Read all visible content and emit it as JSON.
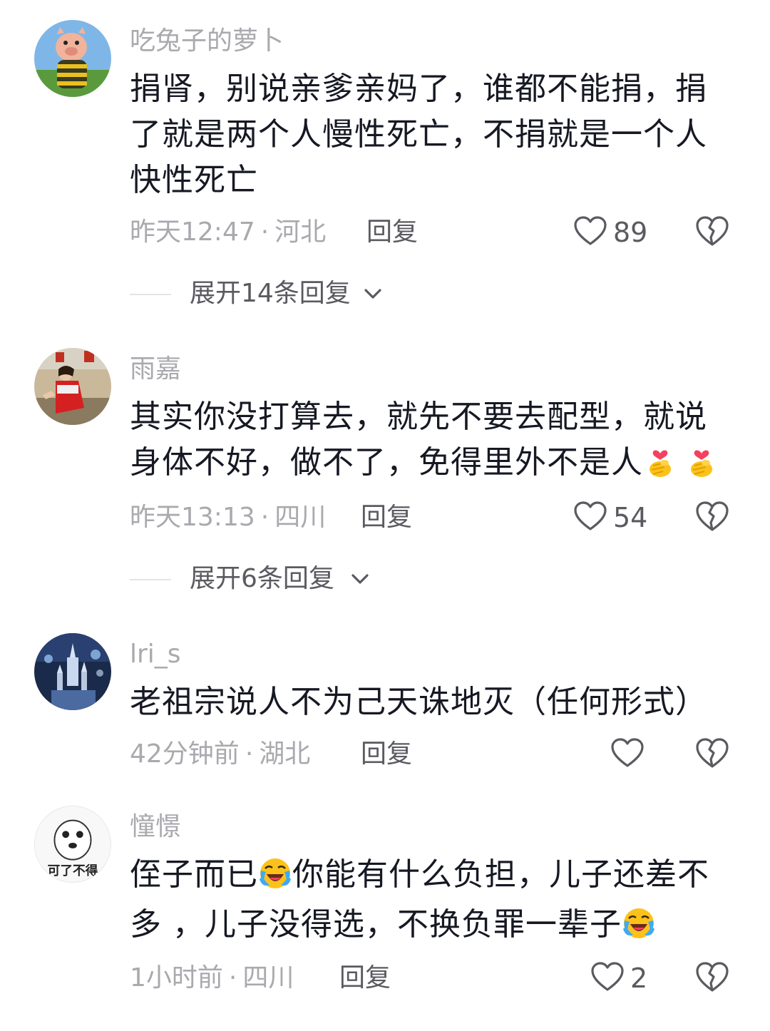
{
  "comments": [
    {
      "username": "吃兔子的萝卜",
      "lines": [
        "捐肾，别说亲爹亲妈了，谁都不能捐，捐",
        "了就是两个人慢性死亡，不捐就是一个人",
        "快性死亡"
      ],
      "time": "昨天12:47",
      "location": "河北",
      "reply_label": "回复",
      "likes": "89",
      "expand_label": "展开14条回复"
    },
    {
      "username": "雨嘉",
      "lines": [
        "其实你没打算去，就先不要去配型，就说",
        "身体不好，做不了，免得里外不是人"
      ],
      "emojis_after_line_2": [
        "finger-heart-emoji",
        "finger-heart-emoji"
      ],
      "time": "昨天13:13",
      "location": "四川",
      "reply_label": "回复",
      "likes": "54",
      "expand_label": "展开6条回复"
    },
    {
      "username": "lri_s",
      "lines": [
        "老祖宗说人不为己天诛地灭（任何形式）"
      ],
      "time": "42分钟前",
      "location": "湖北",
      "reply_label": "回复",
      "likes": ""
    },
    {
      "username": "憧憬",
      "line1_part1": "侄子而已",
      "line1_part2": "你能有什么负担，儿子还差不",
      "line2_part1": "多 ，儿子没得选，不换负罪一辈子",
      "emoji_name": "loudly-crying-laughing-emoji",
      "time": "1小时前",
      "location": "四川",
      "reply_label": "回复",
      "likes": "2"
    }
  ],
  "separator": "·",
  "colors": {
    "text": "#161823",
    "secondary": "#a9a9ae",
    "action": "#5a5a60"
  }
}
